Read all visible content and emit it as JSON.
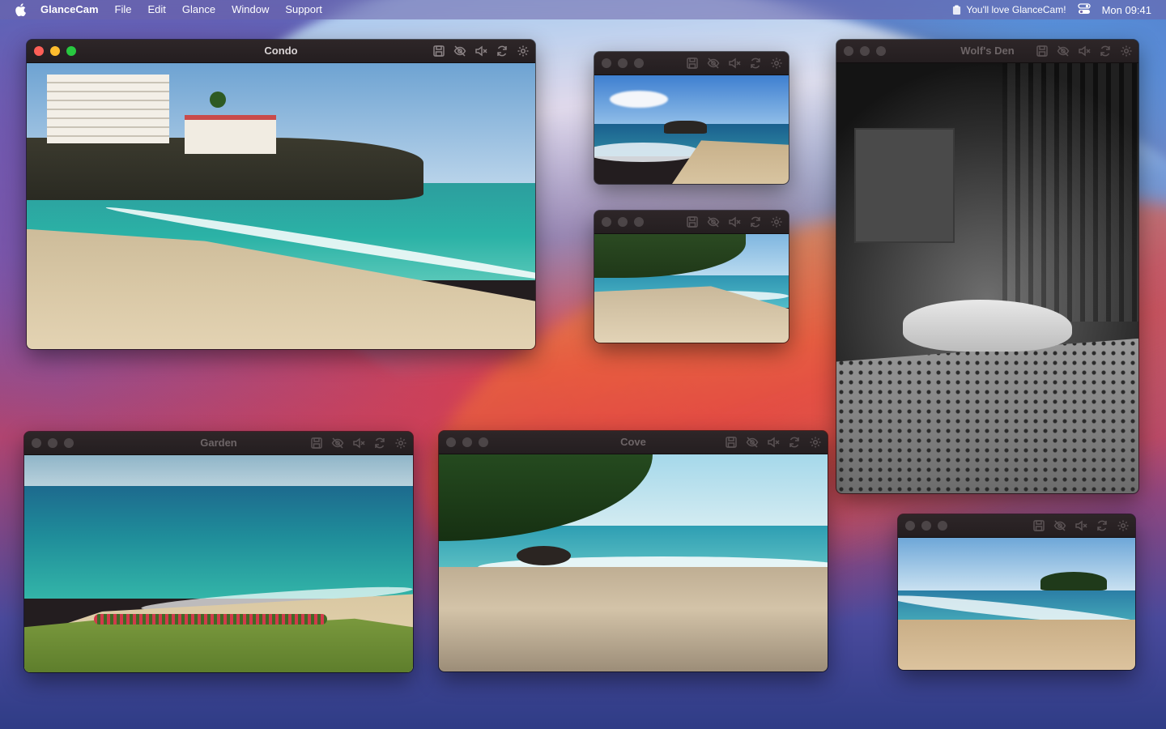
{
  "menubar": {
    "app_name": "GlanceCam",
    "menus": [
      "File",
      "Edit",
      "Glance",
      "Window",
      "Support"
    ],
    "status_message": "You'll love GlanceCam!",
    "clock": "Mon 09:41"
  },
  "toolbar_icons": [
    "save-icon",
    "hide-icon",
    "mute-icon",
    "refresh-icon",
    "settings-icon"
  ],
  "windows": [
    {
      "id": "condo",
      "title": "Condo",
      "active": true
    },
    {
      "id": "cam2",
      "title": "",
      "active": false
    },
    {
      "id": "cam3",
      "title": "",
      "active": false
    },
    {
      "id": "wolf",
      "title": "Wolf's Den",
      "active": false
    },
    {
      "id": "garden",
      "title": "Garden",
      "active": false
    },
    {
      "id": "cove",
      "title": "Cove",
      "active": false
    },
    {
      "id": "cam7",
      "title": "",
      "active": false
    }
  ],
  "colors": {
    "close": "#fe5f57",
    "minimize": "#febc2e",
    "zoom": "#28c840",
    "titlebar": "#2e2628"
  }
}
